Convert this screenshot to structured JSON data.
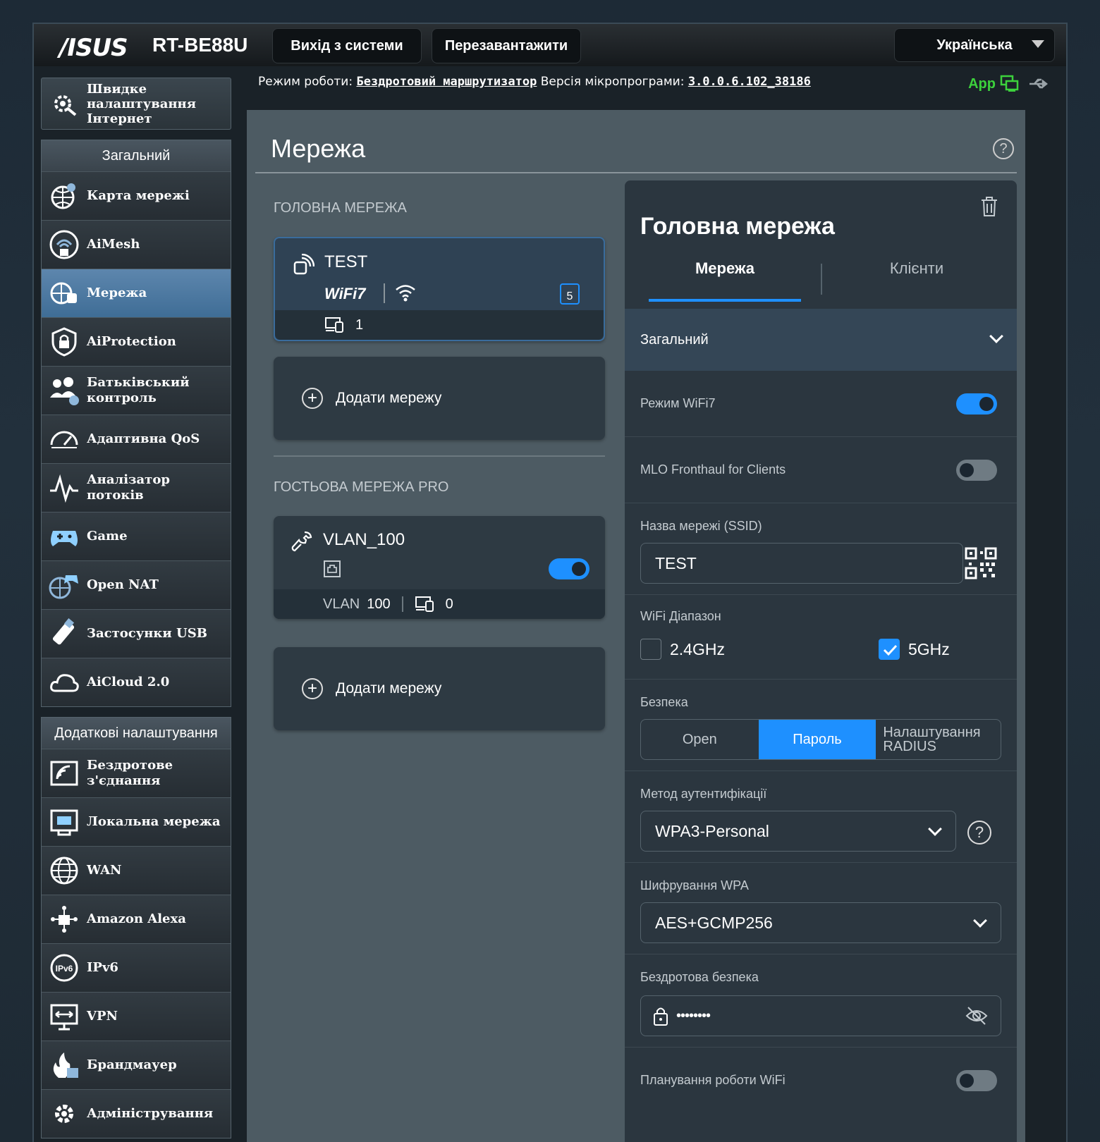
{
  "header": {
    "brand": "/ISUS",
    "model": "RT-BE88U",
    "logout_label": "Вихід з системи",
    "reboot_label": "Перезавантажити",
    "language": "Українська",
    "mode_label": "Режим роботи:",
    "mode_value": "Бездротовий маршрутизатор",
    "firmware_label": "Версія мікропрограми:",
    "firmware_value": "3.0.0.6.102_38186",
    "app_label": "App"
  },
  "sidebar": {
    "quick_setup": "Швидке налаштування Інтернет",
    "general_title": "Загальний",
    "general_items": [
      {
        "label": "Карта мережі",
        "icon": "network-map-icon"
      },
      {
        "label": "AiMesh",
        "icon": "aimesh-icon"
      },
      {
        "label": "Мережа",
        "icon": "network-icon",
        "active": true
      },
      {
        "label": "AiProtection",
        "icon": "shield-icon"
      },
      {
        "label": "Батьківський контроль",
        "icon": "parental-control-icon"
      },
      {
        "label": "Адаптивна QoS",
        "icon": "speedometer-icon"
      },
      {
        "label": "Аналізатор потоків",
        "icon": "traffic-analyzer-icon"
      },
      {
        "label": "Game",
        "icon": "gamepad-icon"
      },
      {
        "label": "Open NAT",
        "icon": "open-nat-icon"
      },
      {
        "label": "Застосунки USB",
        "icon": "usb-icon"
      },
      {
        "label": "AiCloud 2.0",
        "icon": "cloud-icon"
      }
    ],
    "advanced_title": "Додаткові налаштування",
    "advanced_items": [
      {
        "label": "Бездротове з'єднання",
        "icon": "wireless-icon"
      },
      {
        "label": "Локальна мережа",
        "icon": "lan-icon"
      },
      {
        "label": "WAN",
        "icon": "globe-icon"
      },
      {
        "label": "Amazon Alexa",
        "icon": "alexa-icon"
      },
      {
        "label": "IPv6",
        "icon": "ipv6-icon"
      },
      {
        "label": "VPN",
        "icon": "vpn-icon"
      },
      {
        "label": "Брандмауер",
        "icon": "firewall-icon"
      },
      {
        "label": "Адміністрування",
        "icon": "gear-icon"
      }
    ]
  },
  "main": {
    "title": "Мережа",
    "primary_section": "ГОЛОВНА МЕРЕЖА",
    "primary_card": {
      "name": "TEST",
      "wifi_badge": "WiFi7",
      "band_badge": "5",
      "clients": "1"
    },
    "add_network": "Додати мережу",
    "guest_section": "ГОСТЬОВА МЕРЕЖА PRO",
    "guest_card": {
      "name": "VLAN_100",
      "vlan_label": "VLAN",
      "vlan_id": "100",
      "clients": "0",
      "enabled": true
    }
  },
  "panel": {
    "title": "Головна мережа",
    "tab_network": "Мережа",
    "tab_clients": "Клієнти",
    "accordion": "Загальний",
    "wifi7_label": "Режим WiFi7",
    "wifi7_on": true,
    "mlo_label": "MLO Fronthaul for Clients",
    "mlo_on": false,
    "ssid_label": "Назва мережі (SSID)",
    "ssid_value": "TEST",
    "band_label": "WiFi Діапазон",
    "band_24": "2.4GHz",
    "band_24_checked": false,
    "band_5": "5GHz",
    "band_5_checked": true,
    "security_label": "Безпека",
    "security_options": [
      "Open",
      "Пароль",
      "Налаштування RADIUS"
    ],
    "security_selected": "Пароль",
    "auth_label": "Метод аутентифікації",
    "auth_value": "WPA3-Personal",
    "encryption_label": "Шифрування WPA",
    "encryption_value": "AES+GCMP256",
    "wireless_security_label": "Бездротова безпека",
    "password_mask": "••••••••",
    "schedule_label": "Планування роботи WiFi",
    "schedule_on": false
  },
  "colors": {
    "accent": "#1e90ff",
    "app_green": "#3cd13c",
    "active_nav": "#4f7aa3"
  }
}
